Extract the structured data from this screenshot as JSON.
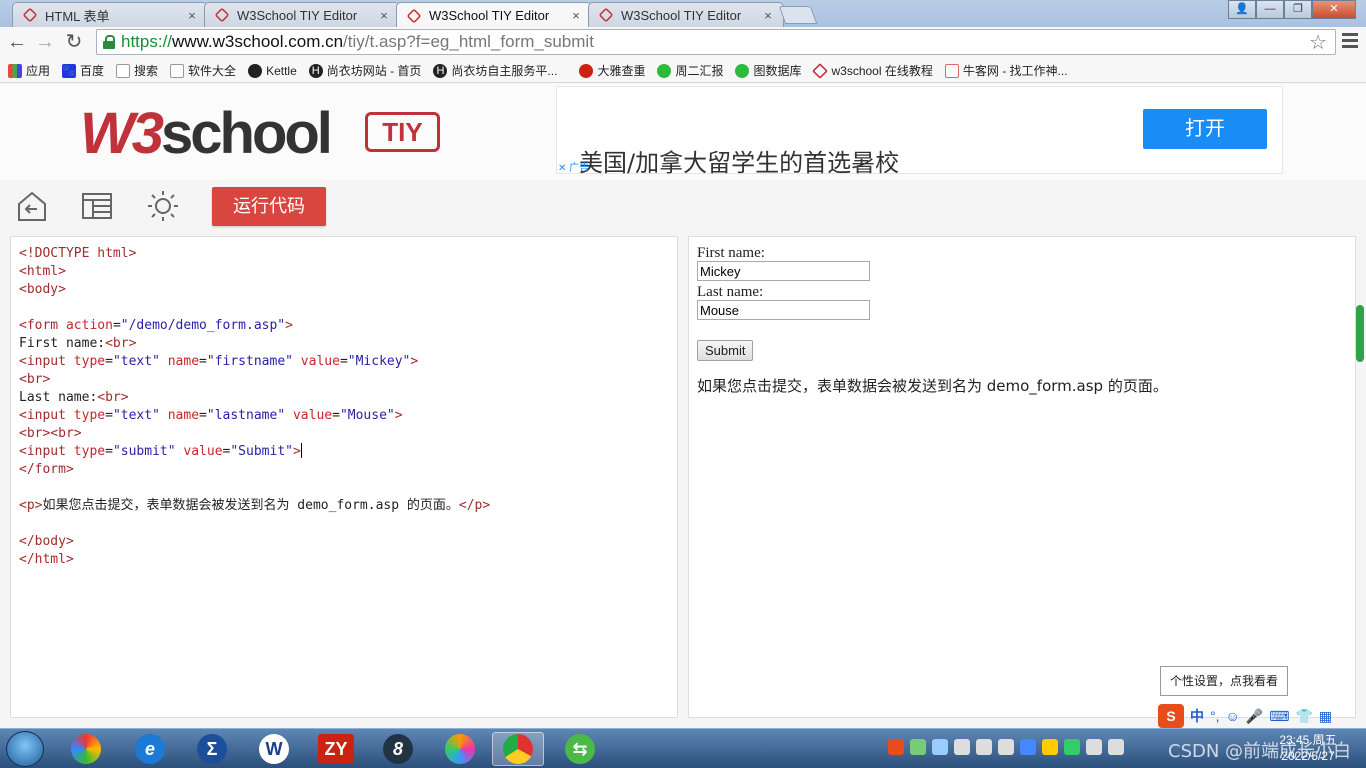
{
  "browser": {
    "tabs": [
      {
        "title": "HTML 表单",
        "close": "×",
        "active": false
      },
      {
        "title": "W3School TIY Editor",
        "close": "×",
        "active": false
      },
      {
        "title": "W3School TIY Editor",
        "close": "×",
        "active": true
      },
      {
        "title": "W3School TIY Editor",
        "close": "×",
        "active": false
      }
    ],
    "url": {
      "scheme": "https://",
      "host": "www.w3school.com.cn",
      "path": "/tiy/t.asp?f=eg_html_form_submit"
    },
    "bookmarks": [
      "应用",
      "百度",
      "搜索",
      "软件大全",
      "Kettle",
      "尚衣坊网站 - 首页",
      "尚衣坊自主服务平...",
      "大雅查重",
      "周二汇报",
      "图数据库",
      "w3school 在线教程",
      "牛客网 - 找工作神..."
    ]
  },
  "header": {
    "logo_w3": "W3",
    "logo_school": "school",
    "logo_tiy": "TIY",
    "ad_text": "美国/加拿大留学生的首选暑校",
    "ad_button": "打开",
    "ad_mark": "✕ 广告"
  },
  "toolbar": {
    "run_label": "运行代码"
  },
  "code_lines": [
    [
      {
        "c": "tg",
        "t": "<!DOCTYPE html>"
      }
    ],
    [
      {
        "c": "tg",
        "t": "<html>"
      }
    ],
    [
      {
        "c": "tg",
        "t": "<body>"
      }
    ],
    [],
    [
      {
        "c": "tg",
        "t": "<form "
      },
      {
        "c": "at",
        "t": "action"
      },
      {
        "c": "tx",
        "t": "="
      },
      {
        "c": "vl",
        "t": "\"/demo/demo_form.asp\""
      },
      {
        "c": "tg",
        "t": ">"
      }
    ],
    [
      {
        "c": "tx",
        "t": "First name:"
      },
      {
        "c": "tg",
        "t": "<br>"
      }
    ],
    [
      {
        "c": "tg",
        "t": "<input "
      },
      {
        "c": "at",
        "t": "type"
      },
      {
        "c": "tx",
        "t": "="
      },
      {
        "c": "vl",
        "t": "\"text\""
      },
      {
        "c": "tx",
        "t": " "
      },
      {
        "c": "at",
        "t": "name"
      },
      {
        "c": "tx",
        "t": "="
      },
      {
        "c": "vl",
        "t": "\"firstname\""
      },
      {
        "c": "tx",
        "t": " "
      },
      {
        "c": "at",
        "t": "value"
      },
      {
        "c": "tx",
        "t": "="
      },
      {
        "c": "vl",
        "t": "\"Mickey\""
      },
      {
        "c": "tg",
        "t": ">"
      }
    ],
    [
      {
        "c": "tg",
        "t": "<br>"
      }
    ],
    [
      {
        "c": "tx",
        "t": "Last name:"
      },
      {
        "c": "tg",
        "t": "<br>"
      }
    ],
    [
      {
        "c": "tg",
        "t": "<input "
      },
      {
        "c": "at",
        "t": "type"
      },
      {
        "c": "tx",
        "t": "="
      },
      {
        "c": "vl",
        "t": "\"text\""
      },
      {
        "c": "tx",
        "t": " "
      },
      {
        "c": "at",
        "t": "name"
      },
      {
        "c": "tx",
        "t": "="
      },
      {
        "c": "vl",
        "t": "\"lastname\""
      },
      {
        "c": "tx",
        "t": " "
      },
      {
        "c": "at",
        "t": "value"
      },
      {
        "c": "tx",
        "t": "="
      },
      {
        "c": "vl",
        "t": "\"Mouse\""
      },
      {
        "c": "tg",
        "t": ">"
      }
    ],
    [
      {
        "c": "tg",
        "t": "<br><br>"
      }
    ],
    [
      {
        "c": "tg",
        "t": "<input "
      },
      {
        "c": "at",
        "t": "type"
      },
      {
        "c": "tx",
        "t": "="
      },
      {
        "c": "vl",
        "t": "\"submit\""
      },
      {
        "c": "tx",
        "t": " "
      },
      {
        "c": "at",
        "t": "value"
      },
      {
        "c": "tx",
        "t": "="
      },
      {
        "c": "vl",
        "t": "\"Submit\""
      },
      {
        "c": "tg",
        "t": ">"
      }
    ],
    [
      {
        "c": "tg",
        "t": "</form>"
      }
    ],
    [],
    [
      {
        "c": "tg",
        "t": "<p>"
      },
      {
        "c": "tx",
        "t": "如果您点击提交，表单数据会被发送到名为 demo_form.asp 的页面。"
      },
      {
        "c": "tg",
        "t": "</p>"
      }
    ],
    [],
    [
      {
        "c": "tg",
        "t": "</body>"
      }
    ],
    [
      {
        "c": "tg",
        "t": "</html>"
      }
    ]
  ],
  "result": {
    "first_label": "First name:",
    "first_value": "Mickey",
    "last_label": "Last name:",
    "last_value": "Mouse",
    "submit_label": "Submit",
    "paragraph": "如果您点击提交，表单数据会被发送到名为 demo_form.asp 的页面。"
  },
  "ime": {
    "tooltip": "个性设置，点我看看",
    "logo": "S",
    "mode": "中",
    "punct": "°,"
  },
  "taskbar": {
    "time": "23:45 周五",
    "date": "2022/5/27",
    "watermark": "CSDN @前端成长小白"
  },
  "colors": {
    "brand_red": "#c0323a",
    "run_button": "#d9463f",
    "ad_button": "#1a8cf5",
    "url_green": "#1a8f32"
  }
}
